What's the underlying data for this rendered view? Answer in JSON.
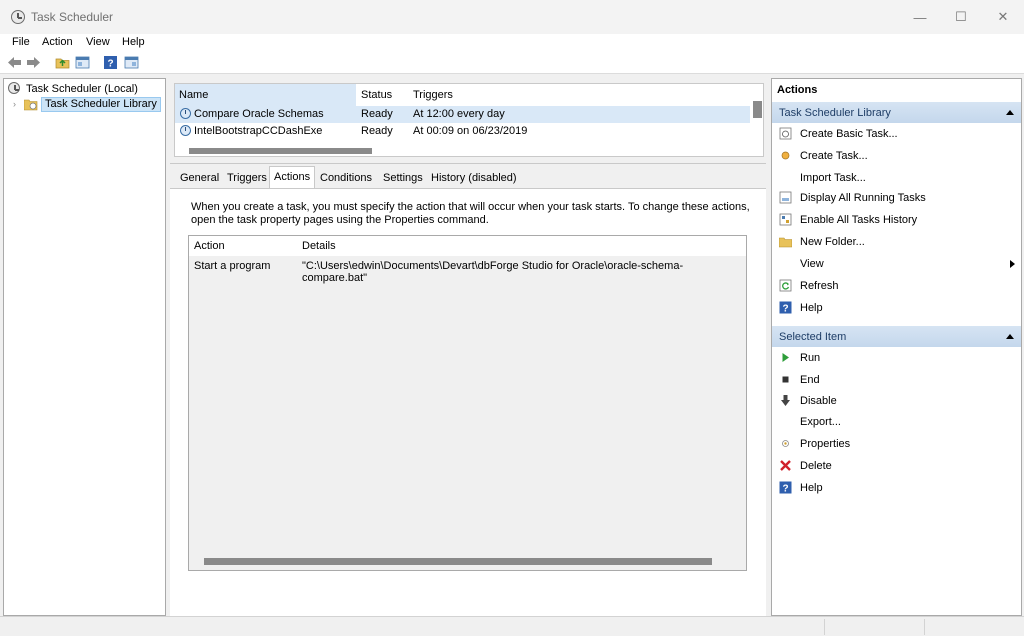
{
  "window": {
    "title": "Task Scheduler",
    "min": "—",
    "max": "☐",
    "close": "✕"
  },
  "menu": [
    "File",
    "Action",
    "View",
    "Help"
  ],
  "toolbar": {
    "back_icon": "back-arrow-icon",
    "forward_icon": "forward-arrow-icon",
    "folder_icon": "folder-up-icon",
    "console_icon": "show-hide-console-tree-icon",
    "help_icon": "help-icon",
    "action_pane_icon": "show-hide-action-pane-icon"
  },
  "tree": {
    "root": "Task Scheduler (Local)",
    "library": "Task Scheduler Library"
  },
  "tasklist": {
    "columns": [
      "Name",
      "Status",
      "Triggers"
    ],
    "rows": [
      {
        "name": "Compare Oracle Schemas",
        "status": "Ready",
        "trigger": "At 12:00 every day"
      },
      {
        "name": "IntelBootstrapCCDashExe",
        "status": "Ready",
        "trigger": "At 00:09 on 06/23/2019"
      }
    ]
  },
  "details": {
    "tabs": [
      "General",
      "Triggers",
      "Actions",
      "Conditions",
      "Settings",
      "History (disabled)"
    ],
    "active_tab": "Actions",
    "description": "When you create a task, you must specify the action that will occur when your task starts.  To change these actions, open the task property pages using the Properties command.",
    "columns": [
      "Action",
      "Details"
    ],
    "rows": [
      {
        "action": "Start a program",
        "details": "\"C:\\Users\\edwin\\Documents\\Devart\\dbForge Studio for Oracle\\oracle-schema-compare.bat\""
      }
    ]
  },
  "actions_pane": {
    "title": "Actions",
    "library_section": "Task Scheduler Library",
    "library_items": [
      "Create Basic Task...",
      "Create Task...",
      "Import Task...",
      "Display All Running Tasks",
      "Enable All Tasks History",
      "New Folder...",
      "View",
      "Refresh",
      "Help"
    ],
    "selected_section": "Selected Item",
    "selected_items": [
      "Run",
      "End",
      "Disable",
      "Export...",
      "Properties",
      "Delete",
      "Help"
    ]
  },
  "colors": {
    "selection": "#cce4f7",
    "section_header": "#c4d7ec",
    "delete_red": "#d0202b",
    "run_green": "#2e9e3a"
  }
}
